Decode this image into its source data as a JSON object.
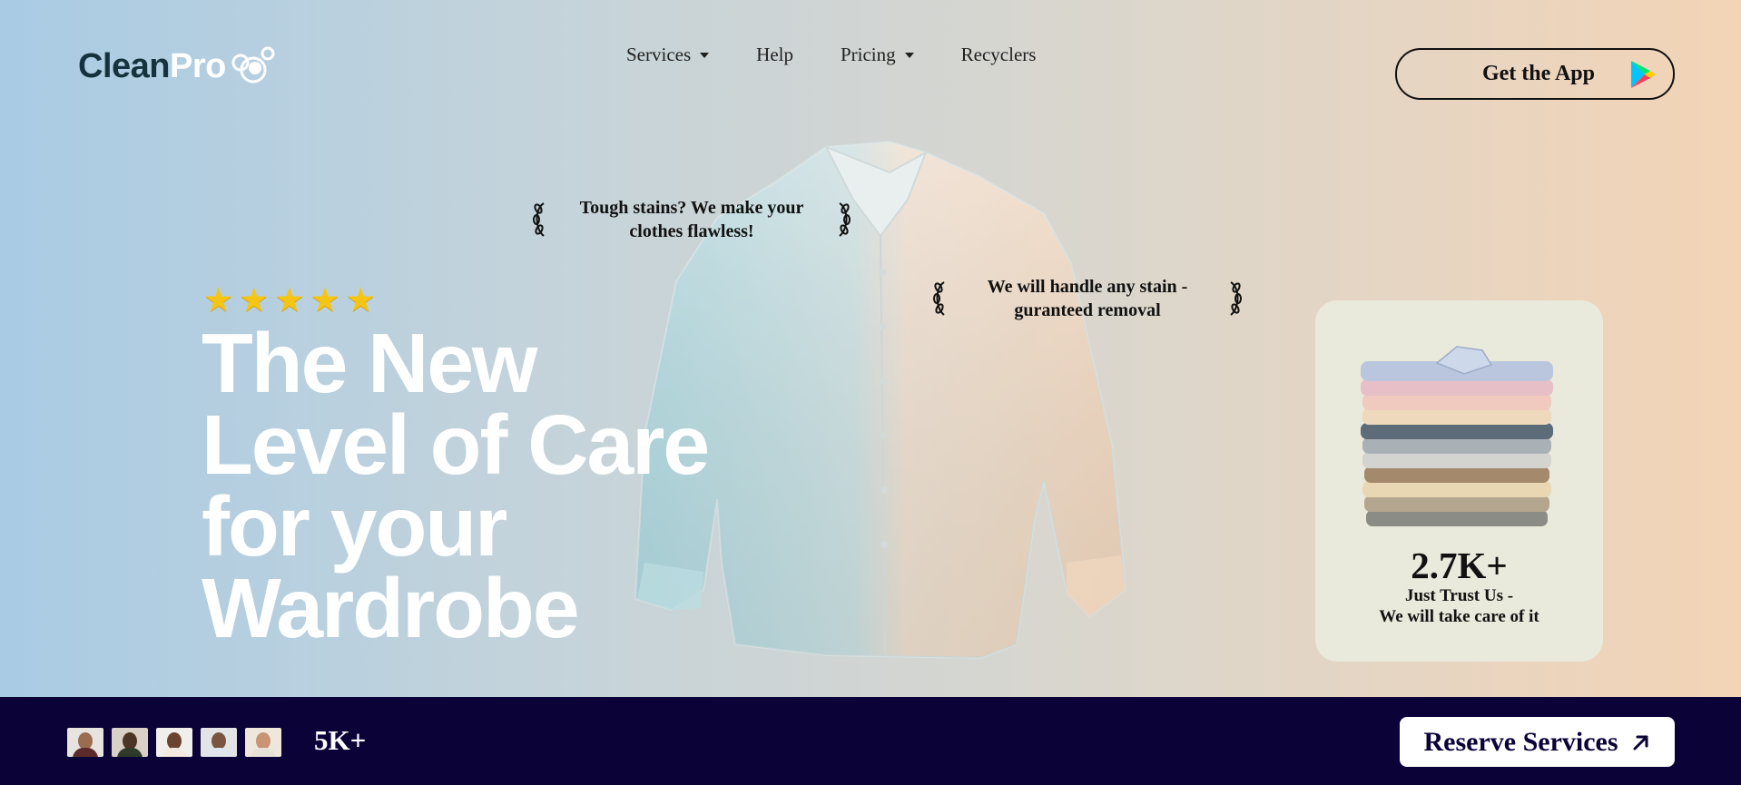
{
  "logo": {
    "part1": "Clean",
    "part2": "Pro"
  },
  "nav": {
    "services": "Services",
    "help": "Help",
    "pricing": "Pricing",
    "recyclers": "Recyclers"
  },
  "get_app": {
    "label": "Get the App",
    "icon": "google-play-icon"
  },
  "quotes": {
    "q1": "Tough stains? We make your clothes flawless!",
    "q2": "We will handle any stain - guranteed removal"
  },
  "rating": {
    "stars": 5,
    "max": 5
  },
  "hero": {
    "line1": "The New",
    "line2": "Level of Care",
    "line3": "for your",
    "line4": "Wardrobe"
  },
  "stats": {
    "value": "2.7K+",
    "line1": "Just Trust Us -",
    "line2": "We will take care of it"
  },
  "bottom": {
    "count": "5K+",
    "reserve_label": "Reserve Services",
    "reserve_icon": "arrow-up-right-icon"
  },
  "colors": {
    "bottom_bar": "#0b0238",
    "star": "#f6c513",
    "card": "#e9e9dc"
  }
}
